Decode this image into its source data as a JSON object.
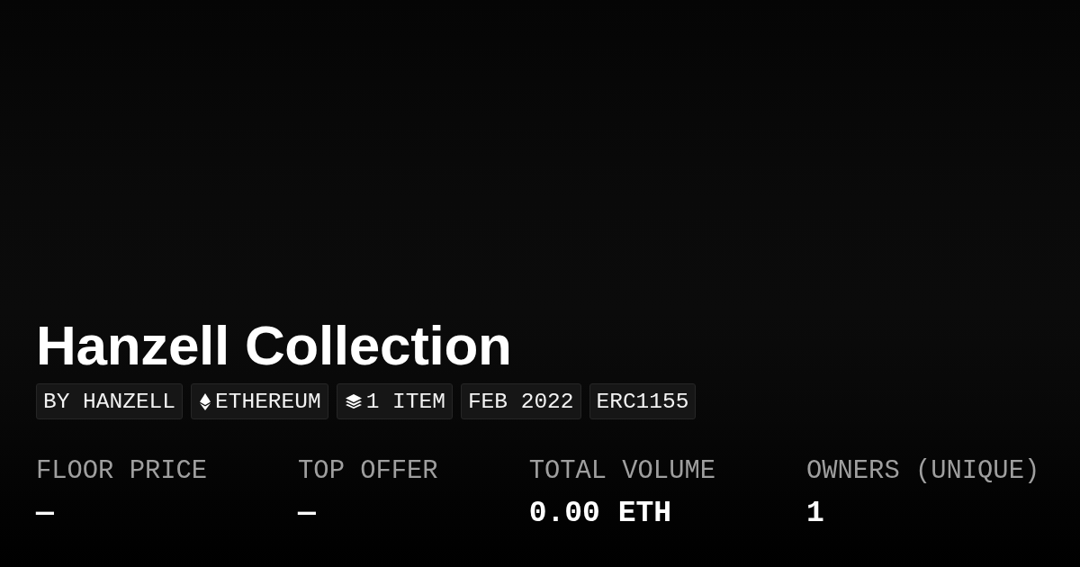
{
  "collection": {
    "title": "Hanzell Collection",
    "tags": [
      {
        "kind": "text",
        "label": "BY HANZELL"
      },
      {
        "kind": "chain",
        "label": "ETHEREUM"
      },
      {
        "kind": "items",
        "label": "1 ITEM"
      },
      {
        "kind": "text",
        "label": "FEB 2022"
      },
      {
        "kind": "text",
        "label": "ERC1155"
      }
    ]
  },
  "stats": [
    {
      "label": "FLOOR PRICE",
      "value": "—"
    },
    {
      "label": "TOP OFFER",
      "value": "—"
    },
    {
      "label": "TOTAL VOLUME",
      "value": "0.00 ETH"
    },
    {
      "label": "OWNERS (UNIQUE)",
      "value": "1"
    }
  ]
}
